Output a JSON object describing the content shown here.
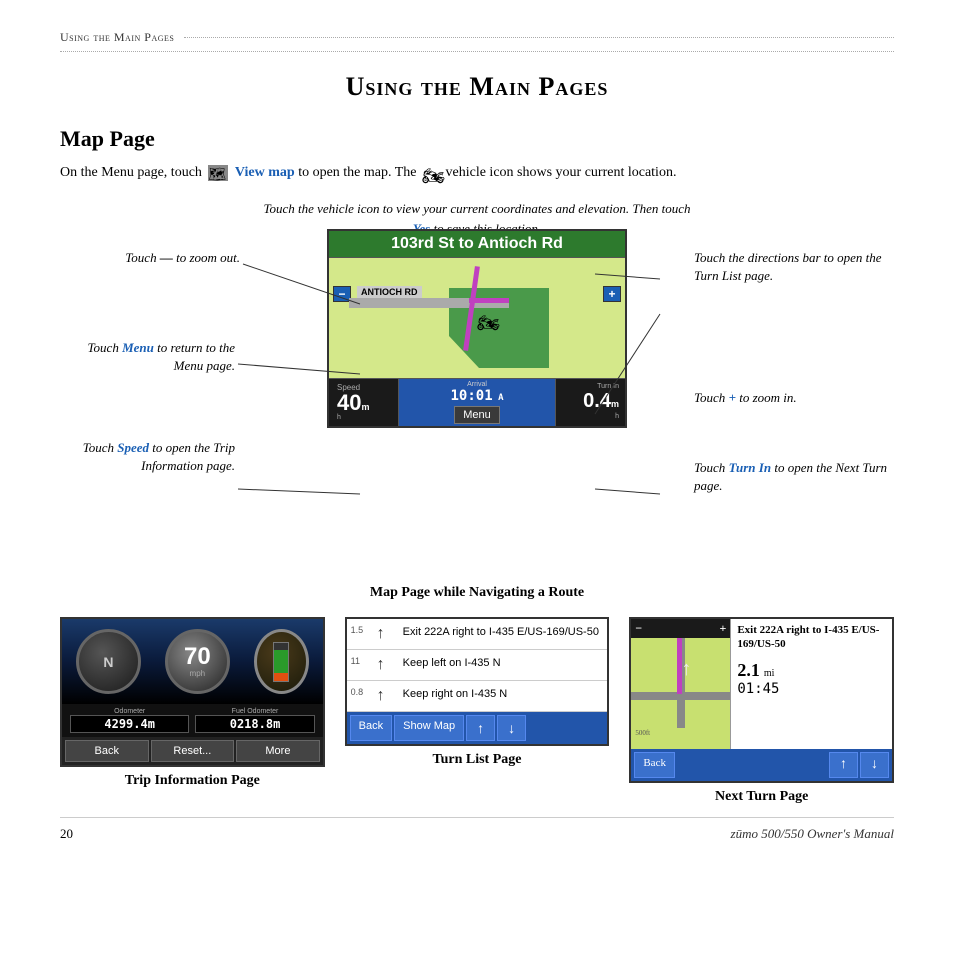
{
  "breadcrumb": {
    "text": "Using the Main Pages"
  },
  "page_title": "Using the Main Pages",
  "section_heading": "Map Page",
  "body_text_1": "On the Menu page, touch",
  "body_text_link": "View map",
  "body_text_2": "to open the map. The",
  "body_text_3": "vehicle icon shows your current location.",
  "callout_top": "Touch the vehicle icon to view your current coordinates and elevation. Then touch",
  "callout_top_link": "Yes",
  "callout_top_end": "to save this location.",
  "callout_left_1": "Touch — to zoom out.",
  "callout_left_2_prefix": "Touch",
  "callout_left_2_link": "Menu",
  "callout_left_2_suffix": "to return to the Menu page.",
  "callout_left_3_prefix": "Touch",
  "callout_left_3_link": "Speed",
  "callout_left_3_suffix": "to open the Trip Information page.",
  "callout_right_1": "Touch the directions bar to open the Turn List page.",
  "callout_right_2_prefix": "Touch",
  "callout_right_2_suffix": "to zoom in.",
  "callout_right_3_prefix": "Touch",
  "callout_right_3_link": "Turn In",
  "callout_right_3_suffix": "to open the Next Turn page.",
  "gps": {
    "header_text": "103rd St to Antioch Rd",
    "road_label": "ANTIOCH RD",
    "zoom_minus": "—",
    "zoom_plus": "+",
    "speed_label": "Speed",
    "speed_value": "40",
    "speed_unit": "mph",
    "arrival_label": "Arrival",
    "arrival_value": "10:01",
    "menu_btn": "Menu",
    "turnin_label": "Turn In",
    "turnin_value": "0.4",
    "turnin_unit": "mi"
  },
  "map_caption": "Map Page while Navigating a Route",
  "panels": {
    "trip": {
      "caption": "Trip Information Page",
      "compass_letter": "N",
      "speed_value": "70",
      "speed_unit": "mph",
      "odometer_label": "Odometer",
      "odometer_value": "4299.4m",
      "fuel_label": "Fuel Odometer",
      "fuel_value": "0218.8m",
      "btn_back": "Back",
      "btn_reset": "Reset...",
      "btn_more": "More"
    },
    "turnlist": {
      "caption": "Turn List Page",
      "turns": [
        {
          "dist": "1.5",
          "arrow": "↑",
          "text": "Exit 222A right to I-435 E/US-169/US-50"
        },
        {
          "dist": "11",
          "arrow": "↑",
          "text": "Keep left on I-435 N"
        },
        {
          "dist": "0.8",
          "arrow": "↑",
          "text": "Keep right on I-435 N"
        }
      ],
      "btn_back": "Back",
      "btn_showmap": "Show Map",
      "btn_up": "↑",
      "btn_down": "↓"
    },
    "nextturn": {
      "caption": "Next Turn Page",
      "map_minus": "−",
      "map_plus": "+",
      "scale": "500ft",
      "street": "Exit 222A right to I-435 E/US-169/US-50",
      "distance": "2.1",
      "distance_unit": "mi",
      "time": "01:45",
      "btn_back": "Back",
      "btn_up": "↑",
      "btn_down": "↓"
    }
  },
  "footer": {
    "page_number": "20",
    "manual_title": "zūmo 500/550 Owner's Manual"
  }
}
